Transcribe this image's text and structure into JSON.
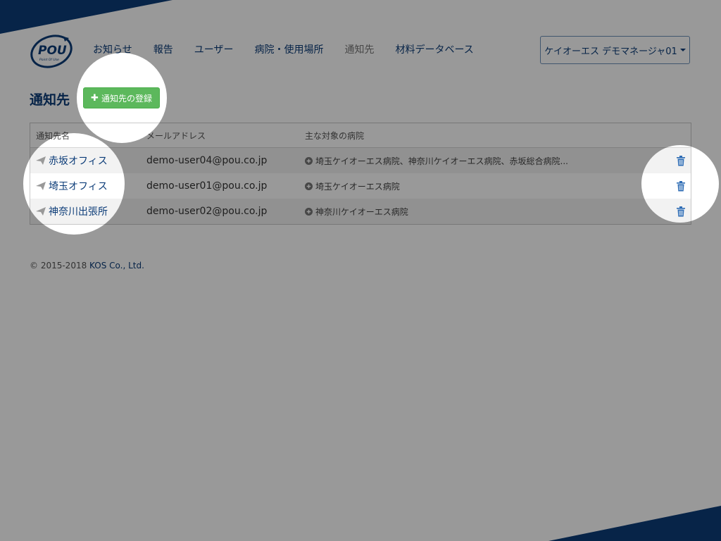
{
  "logo": {
    "text": "POU",
    "subtext": "Point Of Use"
  },
  "nav": {
    "items": [
      "お知らせ",
      "報告",
      "ユーザー",
      "病院・使用場所",
      "通知先",
      "材料データベース"
    ],
    "active": "通知先"
  },
  "user_menu": {
    "label": "ケイオーエス デモマネージャ01"
  },
  "page": {
    "title": "通知先",
    "add_button": "通知先の登録"
  },
  "table": {
    "headers": [
      "通知先名",
      "メールアドレス",
      "主な対象の病院"
    ],
    "rows": [
      {
        "name": "赤坂オフィス",
        "email": "demo-user04@pou.co.jp",
        "hospitals": "埼玉ケイオーエス病院、神奈川ケイオーエス病院、赤坂総合病院..."
      },
      {
        "name": "埼玉オフィス",
        "email": "demo-user01@pou.co.jp",
        "hospitals": "埼玉ケイオーエス病院"
      },
      {
        "name": "神奈川出張所",
        "email": "demo-user02@pou.co.jp",
        "hospitals": "神奈川ケイオーエス病院"
      }
    ]
  },
  "footer": {
    "copyright": "© 2015-2018 ",
    "company": "KOS Co., Ltd."
  },
  "colors": {
    "brand": "#0c3c78",
    "success": "#5cb85c",
    "link": "#2f6db5",
    "overlay": "rgba(0,0,0,0.4)"
  }
}
